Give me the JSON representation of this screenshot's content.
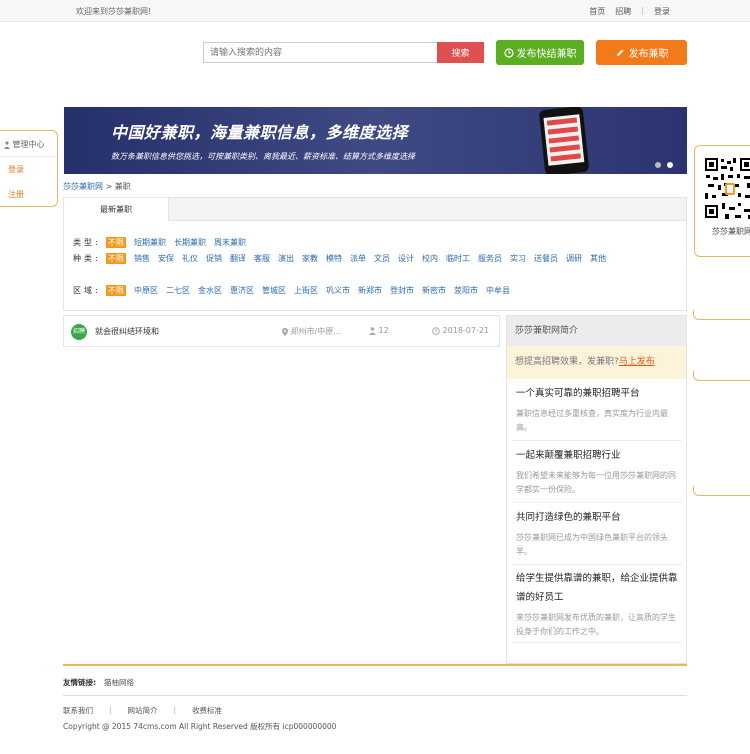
{
  "topbar": {
    "welcome": "欢迎来到莎莎兼职网!",
    "nav": [
      "首页",
      "招聘",
      "登录"
    ],
    "separator": "|"
  },
  "search": {
    "placeholder": "请输入搜索的内容",
    "button": "搜索"
  },
  "header_buttons": {
    "quick_post": "发布快结兼职",
    "post": "发布兼职"
  },
  "left_panel": {
    "title": "管理中心",
    "login": "登录",
    "register": "注册"
  },
  "right_panel": {
    "label": "莎莎兼职网"
  },
  "banner": {
    "title": "中国好兼职，海量兼职信息，多维度选择",
    "subtitle": "数万条兼职信息供您挑选，可按兼职类别、离我最近、薪资标准、结算方式多维度选择"
  },
  "breadcrumb": {
    "home": "莎莎兼职网",
    "sep": " > ",
    "current": "兼职"
  },
  "filters": {
    "tab": "最新兼职",
    "rows": [
      {
        "label": "类型:",
        "items": [
          "不限",
          "短期兼职",
          "长期兼职",
          "周末兼职"
        ]
      },
      {
        "label": "种类:",
        "items": [
          "不限",
          "销售",
          "安保",
          "礼仪",
          "促销",
          "翻译",
          "客服",
          "演出",
          "家教",
          "模特",
          "派单",
          "文员",
          "设计",
          "校内",
          "临时工",
          "服务员",
          "实习",
          "送餐员",
          "调研",
          "其他"
        ]
      },
      {
        "label": "区域:",
        "items": [
          "不限",
          "中原区",
          "二七区",
          "金水区",
          "惠济区",
          "管城区",
          "上街区",
          "巩义市",
          "新郑市",
          "登封市",
          "新密市",
          "荥阳市",
          "中牟县"
        ]
      }
    ]
  },
  "listing": {
    "badge": "招聘",
    "title": "就会很纠结环境和",
    "location": "郑州市/中原...",
    "views": "12",
    "date": "2018-07-21"
  },
  "intro": {
    "head": "莎莎兼职网简介",
    "promo_text": "想提高招聘效果，发兼职?",
    "promo_link": "马上发布",
    "items": [
      {
        "title": "一个真实可靠的兼职招聘平台",
        "desc": "兼职信息经过多重核查，真实度为行业内最高。"
      },
      {
        "title": "一起来颠覆兼职招聘行业",
        "desc": "我们希望未来能够为每一位用莎莎兼职网的同学都实一份保险。"
      },
      {
        "title": "共同打造绿色的兼职平台",
        "desc": "莎莎兼职网已成为中国绿色兼职平台的领头羊。"
      },
      {
        "title": "给学生提供靠谱的兼职，给企业提供靠谱的好员工",
        "desc": "来莎莎兼职网发布优质的兼职，让高质的学生投身于你们的工作之中。"
      }
    ]
  },
  "footer": {
    "friend_label": "友情链接:",
    "friend_link": "猫柚网络",
    "nav": [
      "联系我们",
      "网站简介",
      "收费标准"
    ],
    "sep": "|",
    "copyright": "Copyright @ 2015 74cms.com All Right Reserved 版权所有 icp000000000"
  },
  "colors": {
    "accent_orange": "#f27a1a",
    "accent_green": "#5aae20",
    "search_red": "#e15050",
    "link_blue": "#2a6bb0",
    "panel_border": "#e8b764"
  }
}
